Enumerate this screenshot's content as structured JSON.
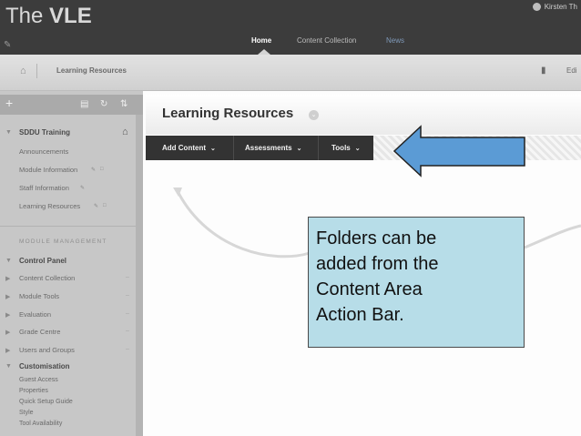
{
  "header": {
    "logo_prefix": "The",
    "logo_name": "VLE",
    "user_name": "Kirsten Th",
    "nav": [
      {
        "label": "Home",
        "active": true
      },
      {
        "label": "Content Collection",
        "active": false
      },
      {
        "label": "News",
        "active": false
      }
    ]
  },
  "breadcrumb": {
    "current": "Learning Resources",
    "edit_label": "Edi"
  },
  "sidebar": {
    "course_title": "SDDU Training",
    "items": [
      "Announcements",
      "Module Information",
      "Staff Information",
      "Learning Resources"
    ],
    "module_management_heading": "MODULE MANAGEMENT",
    "management": [
      "Control Panel",
      "Content Collection",
      "Module Tools",
      "Evaluation",
      "Grade Centre",
      "Users and Groups",
      "Customisation"
    ],
    "customisation_items": [
      "Guest Access",
      "Properties",
      "Quick Setup Guide",
      "Style",
      "Tool Availability"
    ]
  },
  "content": {
    "page_title": "Learning Resources",
    "action_bar": [
      {
        "label": "Add Content"
      },
      {
        "label": "Assessments"
      },
      {
        "label": "Tools"
      }
    ]
  },
  "callout": {
    "lines": [
      "Folders can be",
      "added from the",
      "Content Area",
      "Action Bar."
    ],
    "background_color": "#b7dde8",
    "arrow_color": "#5b9bd5"
  },
  "colors": {
    "header_bg": "#3c3c3c",
    "action_bar_bg": "#333333",
    "sidebar_bg": "#c7c7c7"
  }
}
